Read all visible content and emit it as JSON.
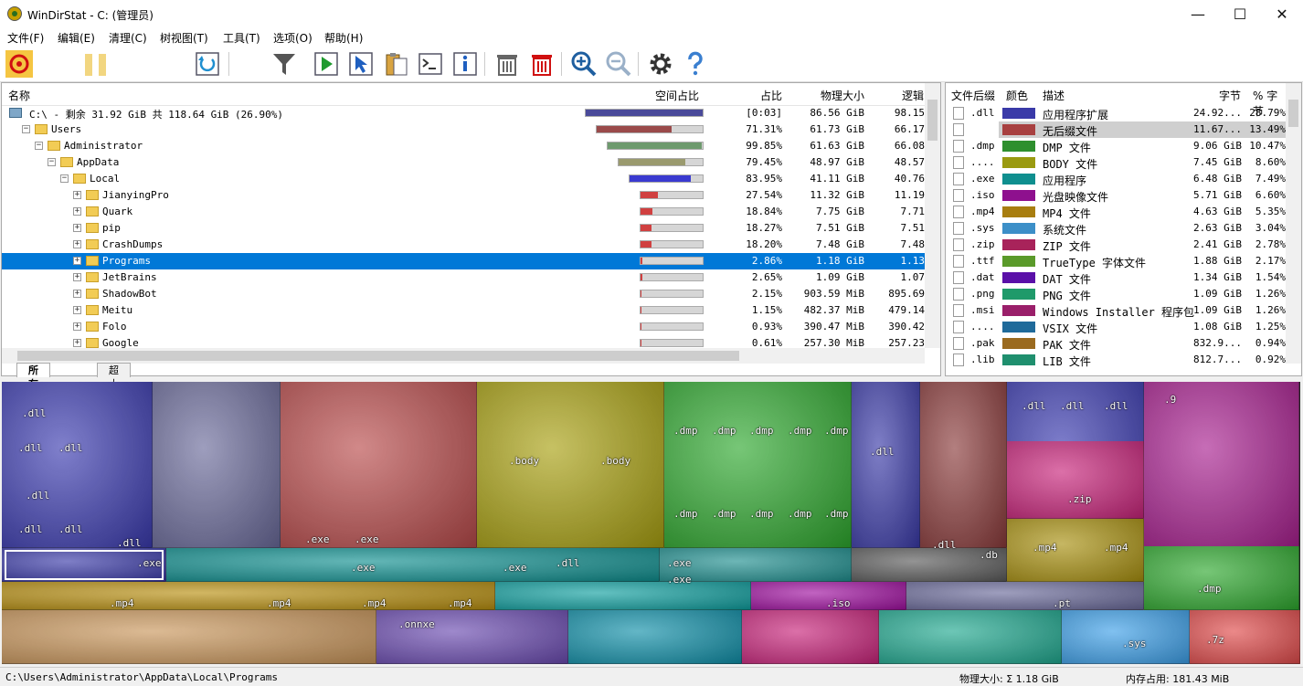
{
  "window": {
    "title": "WinDirStat - C: (管理员)",
    "minimize_glyph": "—",
    "maximize_glyph": "☐",
    "close_glyph": "✕"
  },
  "menu": [
    "文件(F)",
    "编辑(E)",
    "清理(C)",
    "树视图(T)",
    "工具(T)",
    "选项(O)",
    "帮助(H)"
  ],
  "toolbar": {
    "icons": [
      "stop-icon",
      "pause-icon",
      "refresh-icon",
      "filter-icon",
      "open-item-icon",
      "select-icon",
      "copy-path-icon",
      "command-prompt-icon",
      "properties-icon",
      "delete-recycle-icon",
      "delete-permanent-icon",
      "zoom-in-icon",
      "zoom-out-icon",
      "settings-icon",
      "help-icon"
    ]
  },
  "tree": {
    "headers": {
      "name": "名称",
      "ratio": "空间占比",
      "pct": "占比",
      "size": "物理大小",
      "logical": "逻辑"
    },
    "rows": [
      {
        "name": "C:\\ - 剩余 31.92 GiB 共 118.64 GiB (26.90%)",
        "pct": "[0:03]",
        "size": "86.56 GiB",
        "logical": "98.15",
        "level": 0,
        "fill": 1.0,
        "color": "#4a4a9a",
        "type": "drive"
      },
      {
        "name": "Users",
        "pct": "71.31%",
        "size": "61.73 GiB",
        "logical": "66.17",
        "level": 1,
        "fill": 0.71,
        "color": "#9a4a4a",
        "type": "folder"
      },
      {
        "name": "Administrator",
        "pct": "99.85%",
        "size": "61.63 GiB",
        "logical": "66.08",
        "level": 2,
        "fill": 0.99,
        "color": "#6e9a6e",
        "type": "folder"
      },
      {
        "name": "AppData",
        "pct": "79.45%",
        "size": "48.97 GiB",
        "logical": "48.57",
        "level": 3,
        "fill": 0.79,
        "color": "#9a9a6e",
        "type": "folder"
      },
      {
        "name": "Local",
        "pct": "83.95%",
        "size": "41.11 GiB",
        "logical": "40.76",
        "level": 4,
        "fill": 0.84,
        "color": "#3a3ad0",
        "type": "folder"
      },
      {
        "name": "JianyingPro",
        "pct": "27.54%",
        "size": "11.32 GiB",
        "logical": "11.19",
        "level": 5,
        "fill": 0.275,
        "color": "#d04040",
        "type": "folder"
      },
      {
        "name": "Quark",
        "pct": "18.84%",
        "size": "7.75 GiB",
        "logical": "7.71",
        "level": 5,
        "fill": 0.188,
        "color": "#d04040",
        "type": "folder"
      },
      {
        "name": "pip",
        "pct": "18.27%",
        "size": "7.51 GiB",
        "logical": "7.51",
        "level": 5,
        "fill": 0.183,
        "color": "#d04040",
        "type": "folder"
      },
      {
        "name": "CrashDumps",
        "pct": "18.20%",
        "size": "7.48 GiB",
        "logical": "7.48",
        "level": 5,
        "fill": 0.182,
        "color": "#d04040",
        "type": "folder"
      },
      {
        "name": "Programs",
        "pct": "2.86%",
        "size": "1.18 GiB",
        "logical": "1.13",
        "level": 5,
        "fill": 0.029,
        "color": "#d04040",
        "type": "folder",
        "selected": true
      },
      {
        "name": "JetBrains",
        "pct": "2.65%",
        "size": "1.09 GiB",
        "logical": "1.07",
        "level": 5,
        "fill": 0.027,
        "color": "#d04040",
        "type": "folder"
      },
      {
        "name": "ShadowBot",
        "pct": "2.15%",
        "size": "903.59 MiB",
        "logical": "895.69",
        "level": 5,
        "fill": 0.022,
        "color": "#d04040",
        "type": "folder"
      },
      {
        "name": "Meitu",
        "pct": "1.15%",
        "size": "482.37 MiB",
        "logical": "479.14",
        "level": 5,
        "fill": 0.012,
        "color": "#d04040",
        "type": "folder"
      },
      {
        "name": "Folo",
        "pct": "0.93%",
        "size": "390.47 MiB",
        "logical": "390.42",
        "level": 5,
        "fill": 0.009,
        "color": "#d04040",
        "type": "folder"
      },
      {
        "name": "Google",
        "pct": "0.61%",
        "size": "257.30 MiB",
        "logical": "257.23",
        "level": 5,
        "fill": 0.006,
        "color": "#d04040",
        "type": "folder"
      }
    ],
    "tabs": [
      "所有文件",
      "超大文件"
    ]
  },
  "extensions": {
    "headers": {
      "ext": "文件后缀",
      "color": "颜色",
      "desc": "描述",
      "bytes": "字节",
      "pct": "% 字节"
    },
    "rows": [
      {
        "ext": ".dll",
        "color": "#3a3aa8",
        "desc": "应用程序扩展",
        "bytes": "24.92...",
        "pct": "28.79%"
      },
      {
        "ext": "",
        "color": "#a84040",
        "desc": "无后缀文件",
        "bytes": "11.67...",
        "pct": "13.49%",
        "selected": true
      },
      {
        "ext": ".dmp",
        "color": "#2e8f2e",
        "desc": "DMP 文件",
        "bytes": "9.06 GiB",
        "pct": "10.47%"
      },
      {
        "ext": "....",
        "color": "#9a9a10",
        "desc": "BODY 文件",
        "bytes": "7.45 GiB",
        "pct": "8.60%"
      },
      {
        "ext": ".exe",
        "color": "#0f8f8f",
        "desc": "应用程序",
        "bytes": "6.48 GiB",
        "pct": "7.49%"
      },
      {
        "ext": ".iso",
        "color": "#8e108e",
        "desc": "光盘映像文件",
        "bytes": "5.71 GiB",
        "pct": "6.60%"
      },
      {
        "ext": ".mp4",
        "color": "#a87e10",
        "desc": "MP4 文件",
        "bytes": "4.63 GiB",
        "pct": "5.35%"
      },
      {
        "ext": ".sys",
        "color": "#3c8fc8",
        "desc": "系统文件",
        "bytes": "2.63 GiB",
        "pct": "3.04%"
      },
      {
        "ext": ".zip",
        "color": "#a8235a",
        "desc": "ZIP 文件",
        "bytes": "2.41 GiB",
        "pct": "2.78%"
      },
      {
        "ext": ".ttf",
        "color": "#5a9a2a",
        "desc": "TrueType 字体文件",
        "bytes": "1.88 GiB",
        "pct": "2.17%"
      },
      {
        "ext": ".dat",
        "color": "#5a10a8",
        "desc": "DAT 文件",
        "bytes": "1.34 GiB",
        "pct": "1.54%"
      },
      {
        "ext": ".png",
        "color": "#1f9a6a",
        "desc": "PNG 文件",
        "bytes": "1.09 GiB",
        "pct": "1.26%"
      },
      {
        "ext": ".msi",
        "color": "#9a1f6a",
        "desc": "Windows Installer 程序包",
        "bytes": "1.09 GiB",
        "pct": "1.26%"
      },
      {
        "ext": "....",
        "color": "#1f6a9a",
        "desc": "VSIX 文件",
        "bytes": "1.08 GiB",
        "pct": "1.25%"
      },
      {
        "ext": ".pak",
        "color": "#9a6a1f",
        "desc": "PAK 文件",
        "bytes": "832.9...",
        "pct": "0.94%"
      },
      {
        "ext": ".lib",
        "color": "#1f8f6e",
        "desc": "LIB 文件",
        "bytes": "812.7...",
        "pct": "0.92%"
      }
    ]
  },
  "treemap_labels": [
    ".dll",
    ".dll",
    ".dll",
    ".dll",
    ".dll",
    ".dll",
    ".dll",
    ".body",
    ".body",
    ".dmp",
    ".dmp",
    ".dmp",
    ".dmp",
    ".dmp",
    ".dmp",
    ".dmp",
    ".dmp",
    ".dmp",
    ".dmp",
    ".dll",
    ".dll",
    ".dll",
    ".dll",
    ".9",
    ".zip",
    ".mp4",
    ".mp4",
    ".dmp",
    ".exe",
    ".exe",
    ".exe",
    ".exe",
    ".exe",
    ".dll",
    ".exe",
    ".exe",
    ".dll",
    ".db",
    ".mp4",
    ".mp4",
    ".mp4",
    ".mp4",
    ".iso",
    ".pt",
    ".onnxe",
    ".sys",
    ".7z"
  ],
  "status": {
    "path": "C:\\Users\\Administrator\\AppData\\Local\\Programs",
    "size_label": "物理大小: Σ 1.18 GiB",
    "mem_label": "内存占用: 181.43 MiB"
  }
}
